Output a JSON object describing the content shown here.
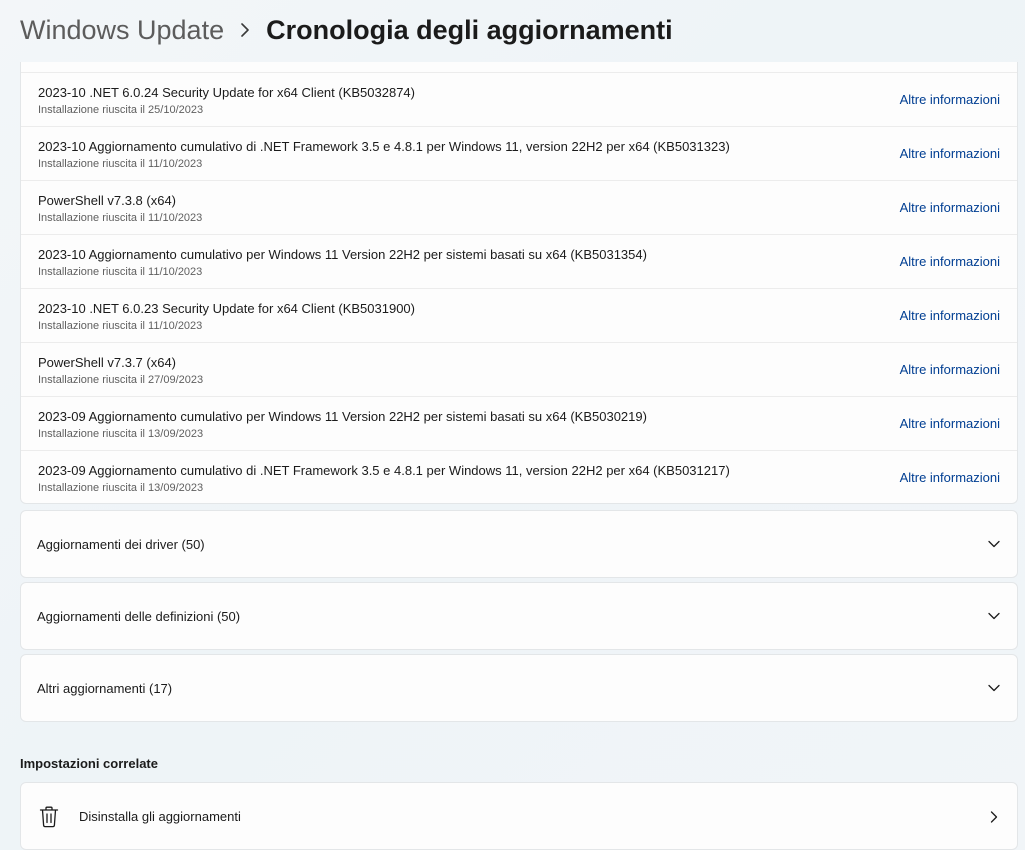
{
  "breadcrumb": {
    "parent": "Windows Update",
    "current": "Cronologia degli aggiornamenti"
  },
  "quality_updates": [
    {
      "title": "2023-10 .NET 6.0.24 Security Update for x64 Client (KB5032874)",
      "status": "Installazione riuscita il 25/10/2023",
      "link": "Altre informazioni"
    },
    {
      "title": "2023-10 Aggiornamento cumulativo di .NET Framework 3.5 e 4.8.1 per Windows 11, version 22H2 per x64 (KB5031323)",
      "status": "Installazione riuscita il 11/10/2023",
      "link": "Altre informazioni"
    },
    {
      "title": "PowerShell v7.3.8 (x64)",
      "status": "Installazione riuscita il 11/10/2023",
      "link": "Altre informazioni"
    },
    {
      "title": "2023-10 Aggiornamento cumulativo per Windows 11 Version 22H2 per sistemi basati su x64 (KB5031354)",
      "status": "Installazione riuscita il 11/10/2023",
      "link": "Altre informazioni"
    },
    {
      "title": "2023-10 .NET 6.0.23 Security Update for x64 Client (KB5031900)",
      "status": "Installazione riuscita il 11/10/2023",
      "link": "Altre informazioni"
    },
    {
      "title": "PowerShell v7.3.7 (x64)",
      "status": "Installazione riuscita il 27/09/2023",
      "link": "Altre informazioni"
    },
    {
      "title": "2023-09 Aggiornamento cumulativo per Windows 11 Version 22H2 per sistemi basati su x64 (KB5030219)",
      "status": "Installazione riuscita il 13/09/2023",
      "link": "Altre informazioni"
    },
    {
      "title": "2023-09 Aggiornamento cumulativo di .NET Framework 3.5 e 4.8.1 per Windows 11, version 22H2 per x64 (KB5031217)",
      "status": "Installazione riuscita il 13/09/2023",
      "link": "Altre informazioni"
    }
  ],
  "expanders": {
    "driver": "Aggiornamenti dei driver (50)",
    "definitions": "Aggiornamenti delle definizioni (50)",
    "other": "Altri aggiornamenti (17)"
  },
  "related_settings": {
    "heading": "Impostazioni correlate",
    "uninstall_label": "Disinstalla gli aggiornamenti"
  },
  "icons": {
    "breadcrumb_separator": "chevron-right-icon",
    "expand": "chevron-down-icon",
    "uninstall": "trash-icon",
    "navigate": "chevron-right-icon"
  },
  "colors": {
    "link": "#003e92",
    "card_background": "#fdfdfd",
    "card_border": "#e3e6e8"
  }
}
